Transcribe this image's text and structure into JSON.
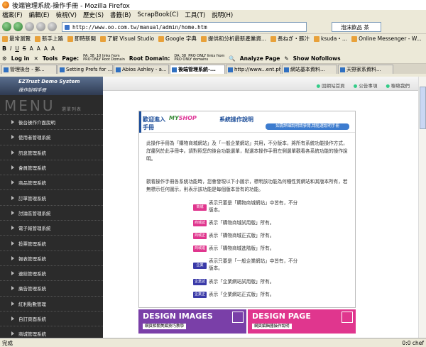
{
  "window": {
    "title": "後端管理系統-操作手冊 - Mozilla Firefox"
  },
  "menu": [
    "檔案(F)",
    "編輯(E)",
    "檢視(V)",
    "歷史(S)",
    "書籤(B)",
    "ScrapBook(C)",
    "工具(T)",
    "說明(H)"
  ],
  "nav": {
    "url": "http://www.oo.com.tw/manual/admin/home.htm",
    "search_placeholder": "泡沫飲品 茶"
  },
  "bookmarks": [
    "最常瀏覽",
    "新手上路",
    "即時新聞",
    "了解 Visual Studio",
    "Google 字典",
    "提供和分析最新產業資...",
    "長ねぎ・豚汁",
    "ksuda・...",
    "Online Messenger - W..."
  ],
  "format_bar": {
    "items": [
      "B",
      "I",
      "U",
      "S",
      "A",
      "A",
      "A",
      "A"
    ]
  },
  "seo_bar": {
    "login": "Log in",
    "tools": "Tools",
    "page_label": "Page:",
    "page_info": "PA: 38  10 links from\nPRO ONLY Root Domain",
    "root_domain_label": "Root Domain:",
    "root_domain_info": "DA: 38  PRO ONLY links from\nPRO ONLY domains",
    "analyze": "Analyze Page",
    "nofollows": "Show Nofollows"
  },
  "tabs": [
    {
      "label": "管理後台 - 郵..."
    },
    {
      "label": "Setting Prefs for ..."
    },
    {
      "label": "Abios Ashley - a..."
    },
    {
      "label": "後端管理系統-..."
    },
    {
      "label": "http://www...ent.php"
    },
    {
      "label": "網站基本資料..."
    },
    {
      "label": "天野家系資料..."
    }
  ],
  "header": {
    "logo": "EZTrust  Demo System",
    "links": [
      "回網站首頁",
      "公告事項",
      "聯絡我們"
    ]
  },
  "sidebar": {
    "logo": "EZTrust Demo System",
    "subtitle": "操作說明手冊",
    "menu_word": "MENU",
    "menu_sub": "選單列表",
    "items": [
      "後台操作介面說明",
      "使用者管理系統",
      "訊息管理系統",
      "會員管理系統",
      "商品管理系統",
      "訂單管理系統",
      "討論區管理系統",
      "電子報管理系統",
      "投票管理系統",
      "報表管理系統",
      "連結管理系統",
      "廣告管理系統",
      "紅利點數管理",
      "自訂頁面系統",
      "商城管理系統"
    ]
  },
  "main": {
    "welcome": "歡迎進入",
    "manual_word": "手冊",
    "brand_my": "MY",
    "brand_shop": "SHOP",
    "system_title": "系統操作說明",
    "blue_button": "如需詳細說明請參閱,請點選說明手冊",
    "para1": "此操作手冊為「購物商城網站」及「一般企業網站」共用，不分版本，將所有系統功能操作方式，詳盡列於此手冊中。請對照您的後台功能選單，點選本操作手冊左側選單觀看各系統功能的操作說明。",
    "para2": "觀看操作手冊各系統功能時，您會發現以下小圖示，標明該功能為何種性質網站和其版本所有，若無標示任何圖示，則表示該功能是每個版本皆有的功能。",
    "legend": [
      {
        "badge": "商城",
        "color": "#e0368e",
        "text": "表示只要是「購物商城網站」中皆有，不分版本。"
      },
      {
        "badge": "商城試用",
        "color": "#e0368e",
        "text": "表示「購物商城試用版」所有。"
      },
      {
        "badge": "商城正式",
        "color": "#e0368e",
        "text": "表示「購物商城正式版」所有。"
      },
      {
        "badge": "商城進階",
        "color": "#e0368e",
        "text": "表示「購物商城進階版」所有。"
      },
      {
        "badge": "企業",
        "color": "#3a3aa8",
        "text": "表示只要是「一般企業網站」中皆有，不分版本。"
      },
      {
        "badge": "企業試用",
        "color": "#3a3aa8",
        "text": "表示「企業網站試用版」所有。"
      },
      {
        "badge": "企業正式",
        "color": "#3a3aa8",
        "text": "表示「企業網站正式版」所有。"
      }
    ]
  },
  "banners": [
    {
      "title": "DESIGN IMAGES",
      "sub": "網頁相關美編技巧教學",
      "color": "#7a3fa8"
    },
    {
      "title": "DESIGN PAGE",
      "sub": "網頁編輯器操作說明",
      "color": "#e0368e"
    }
  ],
  "status": {
    "left": "完成",
    "right": "0:0 chef"
  }
}
